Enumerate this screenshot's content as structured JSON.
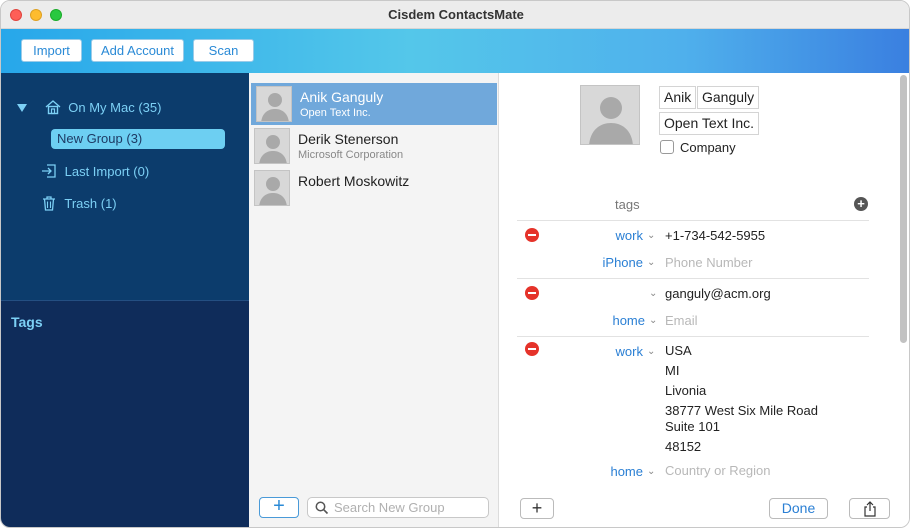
{
  "window": {
    "title": "Cisdem ContactsMate"
  },
  "toolbar": {
    "import_label": "Import",
    "add_account_label": "Add Account",
    "scan_label": "Scan"
  },
  "sidebar": {
    "on_my_mac": "On My Mac (35)",
    "new_group": "New Group (3)",
    "last_import": "Last Import (0)",
    "trash": "Trash (1)",
    "tags_title": "Tags"
  },
  "contacts": [
    {
      "name": "Anik Ganguly",
      "company": "Open Text Inc.",
      "selected": true
    },
    {
      "name": "Derik Stenerson",
      "company": "Microsoft Corporation",
      "selected": false
    },
    {
      "name": "Robert Moskowitz",
      "company": "",
      "selected": false
    }
  ],
  "list_footer": {
    "add_symbol": "+",
    "search_placeholder": "Search New Group"
  },
  "detail": {
    "first_name": "Anik",
    "last_name": "Ganguly",
    "company": "Open Text Inc.",
    "company_checkbox_label": "Company",
    "tags_label": "tags",
    "phone": {
      "label": "work",
      "value": "+1-734-542-5955",
      "new_label": "iPhone",
      "new_placeholder": "Phone Number"
    },
    "email": {
      "label": "",
      "value": "ganguly@acm.org",
      "new_label": "home",
      "new_placeholder": "Email"
    },
    "address": {
      "label": "work",
      "country": "USA",
      "state": "MI",
      "city": "Livonia",
      "street": "38777 West Six Mile Road",
      "street2": "Suite 101",
      "zip": "48152",
      "new_label": "home",
      "new_placeholder": "Country or Region"
    },
    "footer": {
      "add_symbol": "+",
      "done_label": "Done"
    }
  },
  "colors": {
    "accent": "#2a8ad6",
    "sidebar_dark": "#0f2c5a",
    "sidebar_top": "#0c3c6c",
    "selection": "#70a8db",
    "remove_red": "#e5332a"
  },
  "icons": {
    "home": "home-icon",
    "import": "import-icon",
    "trash": "trash-icon",
    "search": "search-icon",
    "share": "share-icon"
  }
}
